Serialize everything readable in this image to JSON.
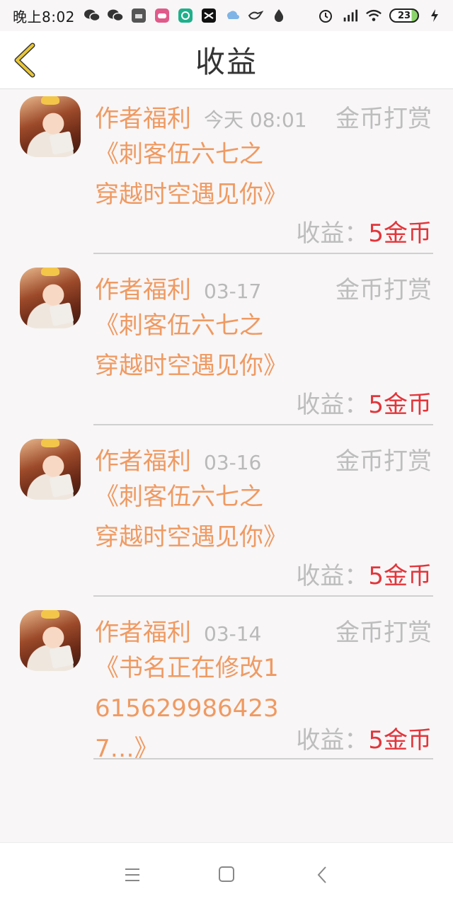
{
  "status_bar": {
    "time": "晚上8:02",
    "battery": "23",
    "left_icons": [
      "wechat-icon",
      "wechat-icon",
      "mi-icon",
      "game-icon",
      "app-icon",
      "capcut-icon",
      "cloud-icon",
      "bird-icon",
      "drop-icon"
    ],
    "right_icons": [
      "alarm-icon",
      "hd-signal-icon",
      "wifi-icon",
      "battery-icon",
      "charging-icon"
    ]
  },
  "header": {
    "title": "收益",
    "back_icon": "chevron-left-icon"
  },
  "items": [
    {
      "author": "作者福利",
      "date": "今天 08:01",
      "type": "金币打赏",
      "title": "《刺客伍六七之穿越时空遇见你》",
      "income_label": "收益：",
      "income_value": "5金币"
    },
    {
      "author": "作者福利",
      "date": "03-17",
      "type": "金币打赏",
      "title": "《刺客伍六七之穿越时空遇见你》",
      "income_label": "收益：",
      "income_value": "5金币"
    },
    {
      "author": "作者福利",
      "date": "03-16",
      "type": "金币打赏",
      "title": "《刺客伍六七之穿越时空遇见你》",
      "income_label": "收益：",
      "income_value": "5金币"
    },
    {
      "author": "作者福利",
      "date": "03-14",
      "type": "金币打赏",
      "title": "《书名正在修改16156299864237…》",
      "income_label": "收益：",
      "income_value": "5金币"
    }
  ],
  "navbar": {
    "buttons": [
      "menu-icon",
      "home-square-icon",
      "back-triangle-icon"
    ]
  },
  "colors": {
    "accent_orange": "#ef9a62",
    "income_red": "#e2353a",
    "muted_gray": "#bdbdbd",
    "back_arrow": "#e8c63a"
  }
}
